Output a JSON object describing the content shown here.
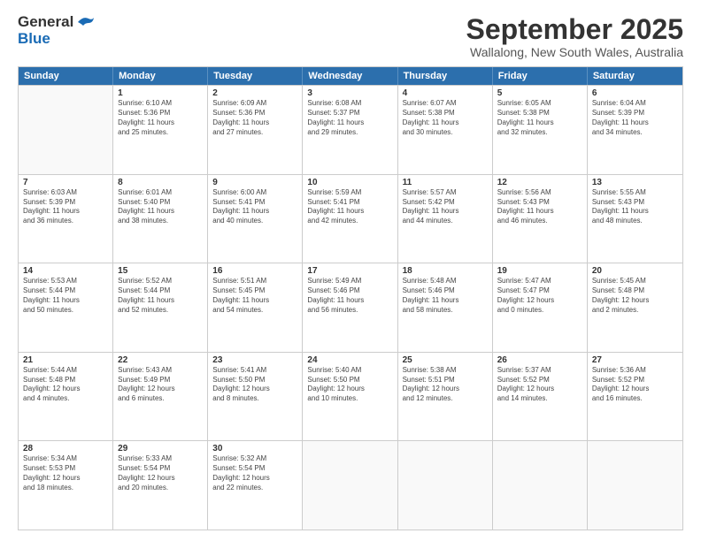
{
  "logo": {
    "line1": "General",
    "line2": "Blue"
  },
  "title": "September 2025",
  "subtitle": "Wallalong, New South Wales, Australia",
  "header_days": [
    "Sunday",
    "Monday",
    "Tuesday",
    "Wednesday",
    "Thursday",
    "Friday",
    "Saturday"
  ],
  "rows": [
    [
      {
        "day": "",
        "lines": []
      },
      {
        "day": "1",
        "lines": [
          "Sunrise: 6:10 AM",
          "Sunset: 5:36 PM",
          "Daylight: 11 hours",
          "and 25 minutes."
        ]
      },
      {
        "day": "2",
        "lines": [
          "Sunrise: 6:09 AM",
          "Sunset: 5:36 PM",
          "Daylight: 11 hours",
          "and 27 minutes."
        ]
      },
      {
        "day": "3",
        "lines": [
          "Sunrise: 6:08 AM",
          "Sunset: 5:37 PM",
          "Daylight: 11 hours",
          "and 29 minutes."
        ]
      },
      {
        "day": "4",
        "lines": [
          "Sunrise: 6:07 AM",
          "Sunset: 5:38 PM",
          "Daylight: 11 hours",
          "and 30 minutes."
        ]
      },
      {
        "day": "5",
        "lines": [
          "Sunrise: 6:05 AM",
          "Sunset: 5:38 PM",
          "Daylight: 11 hours",
          "and 32 minutes."
        ]
      },
      {
        "day": "6",
        "lines": [
          "Sunrise: 6:04 AM",
          "Sunset: 5:39 PM",
          "Daylight: 11 hours",
          "and 34 minutes."
        ]
      }
    ],
    [
      {
        "day": "7",
        "lines": [
          "Sunrise: 6:03 AM",
          "Sunset: 5:39 PM",
          "Daylight: 11 hours",
          "and 36 minutes."
        ]
      },
      {
        "day": "8",
        "lines": [
          "Sunrise: 6:01 AM",
          "Sunset: 5:40 PM",
          "Daylight: 11 hours",
          "and 38 minutes."
        ]
      },
      {
        "day": "9",
        "lines": [
          "Sunrise: 6:00 AM",
          "Sunset: 5:41 PM",
          "Daylight: 11 hours",
          "and 40 minutes."
        ]
      },
      {
        "day": "10",
        "lines": [
          "Sunrise: 5:59 AM",
          "Sunset: 5:41 PM",
          "Daylight: 11 hours",
          "and 42 minutes."
        ]
      },
      {
        "day": "11",
        "lines": [
          "Sunrise: 5:57 AM",
          "Sunset: 5:42 PM",
          "Daylight: 11 hours",
          "and 44 minutes."
        ]
      },
      {
        "day": "12",
        "lines": [
          "Sunrise: 5:56 AM",
          "Sunset: 5:43 PM",
          "Daylight: 11 hours",
          "and 46 minutes."
        ]
      },
      {
        "day": "13",
        "lines": [
          "Sunrise: 5:55 AM",
          "Sunset: 5:43 PM",
          "Daylight: 11 hours",
          "and 48 minutes."
        ]
      }
    ],
    [
      {
        "day": "14",
        "lines": [
          "Sunrise: 5:53 AM",
          "Sunset: 5:44 PM",
          "Daylight: 11 hours",
          "and 50 minutes."
        ]
      },
      {
        "day": "15",
        "lines": [
          "Sunrise: 5:52 AM",
          "Sunset: 5:44 PM",
          "Daylight: 11 hours",
          "and 52 minutes."
        ]
      },
      {
        "day": "16",
        "lines": [
          "Sunrise: 5:51 AM",
          "Sunset: 5:45 PM",
          "Daylight: 11 hours",
          "and 54 minutes."
        ]
      },
      {
        "day": "17",
        "lines": [
          "Sunrise: 5:49 AM",
          "Sunset: 5:46 PM",
          "Daylight: 11 hours",
          "and 56 minutes."
        ]
      },
      {
        "day": "18",
        "lines": [
          "Sunrise: 5:48 AM",
          "Sunset: 5:46 PM",
          "Daylight: 11 hours",
          "and 58 minutes."
        ]
      },
      {
        "day": "19",
        "lines": [
          "Sunrise: 5:47 AM",
          "Sunset: 5:47 PM",
          "Daylight: 12 hours",
          "and 0 minutes."
        ]
      },
      {
        "day": "20",
        "lines": [
          "Sunrise: 5:45 AM",
          "Sunset: 5:48 PM",
          "Daylight: 12 hours",
          "and 2 minutes."
        ]
      }
    ],
    [
      {
        "day": "21",
        "lines": [
          "Sunrise: 5:44 AM",
          "Sunset: 5:48 PM",
          "Daylight: 12 hours",
          "and 4 minutes."
        ]
      },
      {
        "day": "22",
        "lines": [
          "Sunrise: 5:43 AM",
          "Sunset: 5:49 PM",
          "Daylight: 12 hours",
          "and 6 minutes."
        ]
      },
      {
        "day": "23",
        "lines": [
          "Sunrise: 5:41 AM",
          "Sunset: 5:50 PM",
          "Daylight: 12 hours",
          "and 8 minutes."
        ]
      },
      {
        "day": "24",
        "lines": [
          "Sunrise: 5:40 AM",
          "Sunset: 5:50 PM",
          "Daylight: 12 hours",
          "and 10 minutes."
        ]
      },
      {
        "day": "25",
        "lines": [
          "Sunrise: 5:38 AM",
          "Sunset: 5:51 PM",
          "Daylight: 12 hours",
          "and 12 minutes."
        ]
      },
      {
        "day": "26",
        "lines": [
          "Sunrise: 5:37 AM",
          "Sunset: 5:52 PM",
          "Daylight: 12 hours",
          "and 14 minutes."
        ]
      },
      {
        "day": "27",
        "lines": [
          "Sunrise: 5:36 AM",
          "Sunset: 5:52 PM",
          "Daylight: 12 hours",
          "and 16 minutes."
        ]
      }
    ],
    [
      {
        "day": "28",
        "lines": [
          "Sunrise: 5:34 AM",
          "Sunset: 5:53 PM",
          "Daylight: 12 hours",
          "and 18 minutes."
        ]
      },
      {
        "day": "29",
        "lines": [
          "Sunrise: 5:33 AM",
          "Sunset: 5:54 PM",
          "Daylight: 12 hours",
          "and 20 minutes."
        ]
      },
      {
        "day": "30",
        "lines": [
          "Sunrise: 5:32 AM",
          "Sunset: 5:54 PM",
          "Daylight: 12 hours",
          "and 22 minutes."
        ]
      },
      {
        "day": "",
        "lines": []
      },
      {
        "day": "",
        "lines": []
      },
      {
        "day": "",
        "lines": []
      },
      {
        "day": "",
        "lines": []
      }
    ]
  ]
}
